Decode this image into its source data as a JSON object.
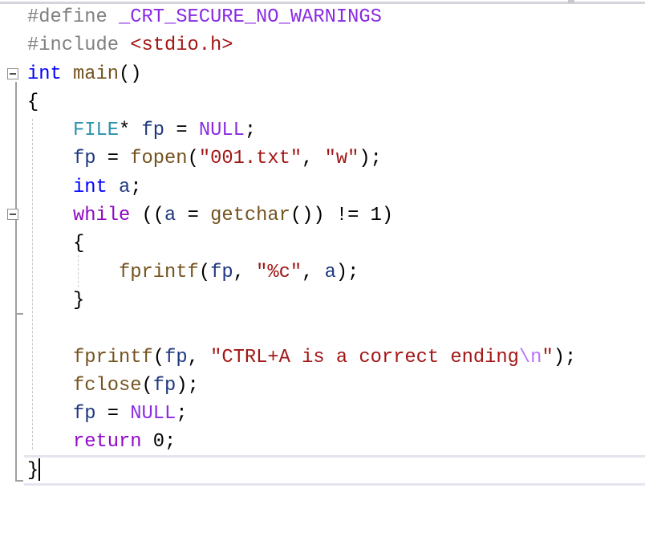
{
  "colors": {
    "pp": "#808080",
    "macro": "#8a2be2",
    "inc": "#a31515",
    "kw": "#0000ff",
    "fn": "#74531f",
    "var": "#1f377f",
    "type": "#2b91af",
    "str": "#a31515",
    "esc": "#b776fb",
    "ctrl": "#8f08c4",
    "plain": "#000000",
    "num": "#000000"
  },
  "editor": {
    "lines": [
      [
        [
          "pp",
          "#define "
        ],
        [
          "macro",
          "_CRT_SECURE_NO_WARNINGS"
        ]
      ],
      [
        [
          "pp",
          "#include "
        ],
        [
          "inc",
          "<stdio.h>"
        ]
      ],
      [
        [
          "kw",
          "int"
        ],
        [
          "plain",
          " "
        ],
        [
          "fn",
          "main"
        ],
        [
          "plain",
          "()"
        ]
      ],
      [
        [
          "plain",
          "{"
        ]
      ],
      [
        [
          "plain",
          "    "
        ],
        [
          "type",
          "FILE"
        ],
        [
          "plain",
          "* "
        ],
        [
          "var",
          "fp"
        ],
        [
          "plain",
          " = "
        ],
        [
          "macro",
          "NULL"
        ],
        [
          "plain",
          ";"
        ]
      ],
      [
        [
          "plain",
          "    "
        ],
        [
          "var",
          "fp"
        ],
        [
          "plain",
          " = "
        ],
        [
          "fn",
          "fopen"
        ],
        [
          "plain",
          "("
        ],
        [
          "str",
          "\"001.txt\""
        ],
        [
          "plain",
          ", "
        ],
        [
          "str",
          "\"w\""
        ],
        [
          "plain",
          ");"
        ]
      ],
      [
        [
          "plain",
          "    "
        ],
        [
          "kw",
          "int"
        ],
        [
          "plain",
          " "
        ],
        [
          "var",
          "a"
        ],
        [
          "plain",
          ";"
        ]
      ],
      [
        [
          "plain",
          "    "
        ],
        [
          "ctrl",
          "while"
        ],
        [
          "plain",
          " (("
        ],
        [
          "var",
          "a"
        ],
        [
          "plain",
          " = "
        ],
        [
          "fn",
          "getchar"
        ],
        [
          "plain",
          "()) != 1)"
        ]
      ],
      [
        [
          "plain",
          "    {"
        ]
      ],
      [
        [
          "plain",
          "        "
        ],
        [
          "fn",
          "fprintf"
        ],
        [
          "plain",
          "("
        ],
        [
          "var",
          "fp"
        ],
        [
          "plain",
          ", "
        ],
        [
          "str",
          "\"%c\""
        ],
        [
          "plain",
          ", "
        ],
        [
          "var",
          "a"
        ],
        [
          "plain",
          ");"
        ]
      ],
      [
        [
          "plain",
          "    }"
        ]
      ],
      [],
      [
        [
          "plain",
          "    "
        ],
        [
          "fn",
          "fprintf"
        ],
        [
          "plain",
          "("
        ],
        [
          "var",
          "fp"
        ],
        [
          "plain",
          ", "
        ],
        [
          "str",
          "\"CTRL+A is a correct ending"
        ],
        [
          "esc",
          "\\n"
        ],
        [
          "str",
          "\""
        ],
        [
          "plain",
          ");"
        ]
      ],
      [
        [
          "plain",
          "    "
        ],
        [
          "fn",
          "fclose"
        ],
        [
          "plain",
          "("
        ],
        [
          "var",
          "fp"
        ],
        [
          "plain",
          ");"
        ]
      ],
      [
        [
          "plain",
          "    "
        ],
        [
          "var",
          "fp"
        ],
        [
          "plain",
          " = "
        ],
        [
          "macro",
          "NULL"
        ],
        [
          "plain",
          ";"
        ]
      ],
      [
        [
          "plain",
          "    "
        ],
        [
          "ctrl",
          "return"
        ],
        [
          "plain",
          " 0;"
        ]
      ],
      [
        [
          "plain",
          "}"
        ]
      ]
    ]
  }
}
